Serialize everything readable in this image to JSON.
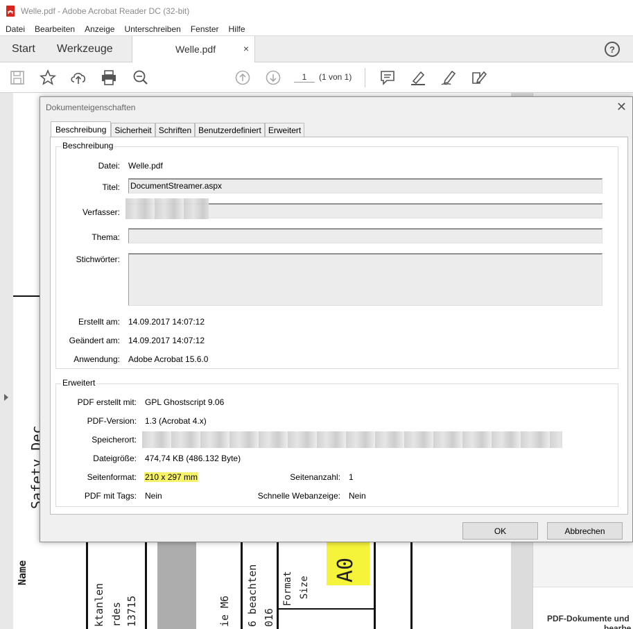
{
  "window": {
    "title": "Welle.pdf - Adobe Acrobat Reader DC (32-bit)"
  },
  "menu": [
    "Datei",
    "Bearbeiten",
    "Anzeige",
    "Unterschreiben",
    "Fenster",
    "Hilfe"
  ],
  "tabs_bar": {
    "start": "Start",
    "tools": "Werkzeuge",
    "document": "Welle.pdf",
    "close": "×",
    "help": "?"
  },
  "toolbar": {
    "page_number": "1",
    "page_of": "(1 von 1)"
  },
  "document_page": {
    "rotated_texts": [
      "Safety Dec.",
      "Name",
      "ktanlen",
      "rdes",
      "13715",
      "ie M6",
      "6 beachten",
      "016",
      "Format",
      "Size",
      "A0"
    ]
  },
  "right_panel": {
    "promo_line1": "PDF-Dokumente und",
    "promo_line2": "bearbe"
  },
  "dialog": {
    "title": "Dokumenteigenschaften",
    "close": "✕",
    "tabs": [
      "Beschreibung",
      "Sicherheit",
      "Schriften",
      "Benutzerdefiniert",
      "Erweitert"
    ],
    "description": {
      "group_label": "Beschreibung",
      "file_label": "Datei:",
      "file_value": "Welle.pdf",
      "title_label": "Titel:",
      "title_value": "DocumentStreamer.aspx",
      "author_label": "Verfasser:",
      "author_value": "",
      "subject_label": "Thema:",
      "subject_value": "",
      "keywords_label": "Stichwörter:",
      "keywords_value": "",
      "created_label": "Erstellt am:",
      "created_value": "14.09.2017 14:07:12",
      "modified_label": "Geändert am:",
      "modified_value": "14.09.2017 14:07:12",
      "application_label": "Anwendung:",
      "application_value": "Adobe Acrobat 15.6.0"
    },
    "advanced": {
      "group_label": "Erweitert",
      "producer_label": "PDF erstellt mit:",
      "producer_value": "GPL Ghostscript 9.06",
      "version_label": "PDF-Version:",
      "version_value": "1.3 (Acrobat 4.x)",
      "location_label": "Speicherort:",
      "location_value": "",
      "filesize_label": "Dateigröße:",
      "filesize_value": "474,74 KB (486.132 Byte)",
      "pageformat_label": "Seitenformat:",
      "pageformat_value": "210 x 297 mm",
      "pagecount_label": "Seitenanzahl:",
      "pagecount_value": "1",
      "tagged_label": "PDF mit Tags:",
      "tagged_value": "Nein",
      "fastweb_label": "Schnelle Webanzeige:",
      "fastweb_value": "Nein"
    },
    "ok": "OK",
    "cancel": "Abbrechen"
  },
  "colors": {
    "highlight": "#f7f26a",
    "pdf_red": "#d7261e"
  },
  "icons": {
    "save": "save-icon",
    "bookmark": "star-icon",
    "upload": "cloud-upload-icon",
    "print": "printer-icon",
    "zoom": "zoom-out-icon",
    "prev_page": "arrow-up-circle-icon",
    "next_page": "arrow-down-circle-icon",
    "comment": "comment-icon",
    "highlight": "highlighter-pen-icon",
    "sign": "sign-pen-icon",
    "fill_sign": "fill-sign-icon"
  }
}
